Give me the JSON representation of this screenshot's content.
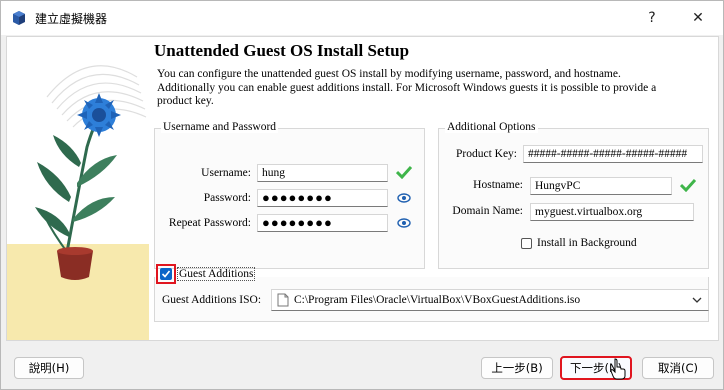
{
  "window": {
    "title": "建立虛擬機器",
    "help_label": "?",
    "close_label": "✕"
  },
  "page": {
    "heading": "Unattended Guest OS Install Setup",
    "intro": "You can configure the unattended guest OS install by modifying username, password, and hostname. Additionally you can enable guest additions install. For Microsoft Windows guests it is possible to provide a product key."
  },
  "user_group": {
    "title": "Username and Password",
    "username_label": "Username:",
    "username_value": "hung",
    "password_label": "Password:",
    "password_value": "●●●●●●●●",
    "repeat_label": "Repeat Password:",
    "repeat_value": "●●●●●●●●"
  },
  "additional_group": {
    "title": "Additional Options",
    "product_key_label": "Product Key:",
    "product_key_value": "#####-#####-#####-#####-#####",
    "hostname_label": "Hostname:",
    "hostname_value": "HungvPC",
    "domain_label": "Domain Name:",
    "domain_value": "myguest.virtualbox.org",
    "background_label": "Install in Background",
    "background_checked": false
  },
  "guest_additions": {
    "label": "Guest Additions",
    "checked": true,
    "iso_label": "Guest Additions ISO:",
    "iso_value": "C:\\Program Files\\Oracle\\VirtualBox\\VBoxGuestAdditions.iso"
  },
  "buttons": {
    "help": "說明(H)",
    "back": "上一步(B)",
    "next": "下一步(N)",
    "cancel": "取消(C)"
  },
  "icons": {
    "app": "virtualbox-icon",
    "valid": "green-check-icon",
    "reveal": "eye-icon",
    "dropdown": "chevron-down-icon",
    "iso_file": "file-icon"
  },
  "colors": {
    "accent": "#0a64c8",
    "highlight": "#e0151f",
    "valid": "#3fb54a"
  }
}
